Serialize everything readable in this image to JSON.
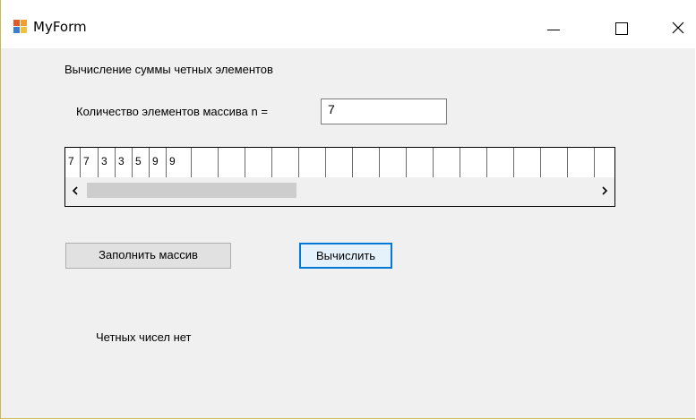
{
  "window": {
    "title": "MyForm",
    "icon": "app-form-icon",
    "controls": [
      "minimize-icon",
      "maximize-icon",
      "close-icon"
    ]
  },
  "form": {
    "heading": "Вычисление суммы четных элементов",
    "count_label": "Количество элементов массива n =",
    "count_value": "7",
    "array_cells": [
      "7",
      "7",
      "3",
      "3",
      "5",
      "9",
      "9",
      "",
      "",
      "",
      "",
      "",
      "",
      "",
      "",
      "",
      "",
      "",
      "",
      "",
      "",
      ""
    ],
    "scroll_left": "‹",
    "scroll_right": "›",
    "fill_button": "Заполнить массив",
    "calc_button": "Вычислить",
    "result": "Четных чисел нет"
  },
  "colors": {
    "accent": "#0078d7",
    "form_background": "#f0f0f0",
    "window_border": "#c9b94a"
  }
}
